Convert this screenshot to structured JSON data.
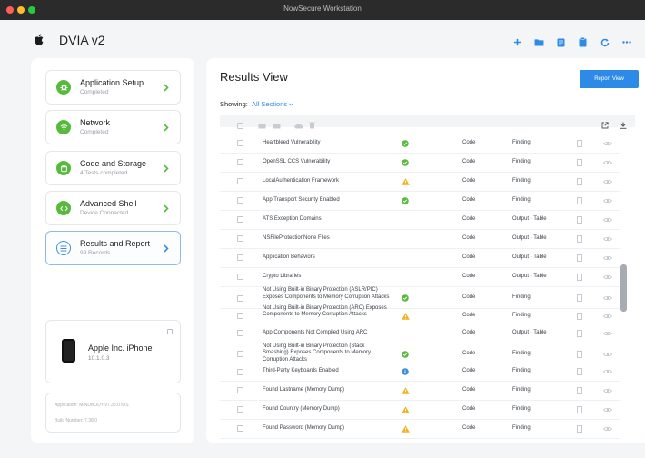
{
  "window": {
    "title": "NowSecure Workstation"
  },
  "header": {
    "app_name": "DVIA v2",
    "toolbar_icons": [
      "plus-icon",
      "folder-icon",
      "document-icon",
      "clipboard-icon",
      "refresh-icon",
      "more-icon"
    ]
  },
  "sidebar": {
    "items": [
      {
        "title": "Application Setup",
        "subtitle": "Completed",
        "icon": "gear-icon"
      },
      {
        "title": "Network",
        "subtitle": "Completed",
        "icon": "wifi-icon"
      },
      {
        "title": "Code and Storage",
        "subtitle": "4 Tests completed",
        "icon": "storage-icon"
      },
      {
        "title": "Advanced Shell",
        "subtitle": "Device Connected",
        "icon": "code-icon"
      },
      {
        "title": "Results and Report",
        "subtitle": "99 Records",
        "icon": "report-icon"
      }
    ],
    "device": {
      "name": "Apple Inc. iPhone",
      "version": "10.1.0.3"
    },
    "build": {
      "application": "Application: MINDBODY v7.38.0 iOS",
      "build_number": "Build Number: 7.38.0"
    }
  },
  "results": {
    "title": "Results View",
    "report_button": "Report View",
    "showing_label": "Showing:",
    "showing_value": "All Sections",
    "rows": [
      {
        "name": "Heartbleed Vulnerability",
        "status": "pass",
        "category": "Code",
        "type": "Finding"
      },
      {
        "name": "OpenSSL CCS Vulnerability",
        "status": "pass",
        "category": "Code",
        "type": "Finding"
      },
      {
        "name": "LocalAuthentication Framework",
        "status": "warn",
        "category": "Code",
        "type": "Finding"
      },
      {
        "name": "App Transport Security Enabled",
        "status": "pass",
        "category": "Code",
        "type": "Finding"
      },
      {
        "name": "ATS Exception Domains",
        "status": "",
        "category": "Code",
        "type": "Output - Table"
      },
      {
        "name": "NSFileProtectionNone Files",
        "status": "",
        "category": "Code",
        "type": "Output - Table"
      },
      {
        "name": "Application Behaviors",
        "status": "",
        "category": "Code",
        "type": "Output - Table"
      },
      {
        "name": "Crypto Libraries",
        "status": "",
        "category": "Code",
        "type": "Output - Table"
      },
      {
        "name": "Not Using Built-in Binary Protection (ASLR/PIC) Exposes Components to Memory Corruption Attacks",
        "status": "pass",
        "category": "Code",
        "type": "Finding"
      },
      {
        "name": "Not Using Built-in Binary Protection (ARC) Exposes Components to Memory Corruption Attacks",
        "status": "warn",
        "category": "Code",
        "type": "Finding"
      },
      {
        "name": "App Components Not Compiled Using ARC",
        "status": "",
        "category": "Code",
        "type": "Output - Table"
      },
      {
        "name": "Not Using Built-in Binary Protection (Stack Smashing) Exposes Components to Memory Corruption Attacks",
        "status": "pass",
        "category": "Code",
        "type": "Finding"
      },
      {
        "name": "Third-Party Keyboards Enabled",
        "status": "info",
        "category": "Code",
        "type": "Finding"
      },
      {
        "name": "Found Lastname (Memory Dump)",
        "status": "warn",
        "category": "Code",
        "type": "Finding"
      },
      {
        "name": "Found Country (Memory Dump)",
        "status": "warn",
        "category": "Code",
        "type": "Finding"
      },
      {
        "name": "Found Password (Memory Dump)",
        "status": "warn",
        "category": "Code",
        "type": "Finding"
      }
    ]
  },
  "colors": {
    "accent": "#2d8ae6",
    "pass": "#58ba3c",
    "warn": "#f2b21c",
    "info": "#3b8fe0"
  }
}
